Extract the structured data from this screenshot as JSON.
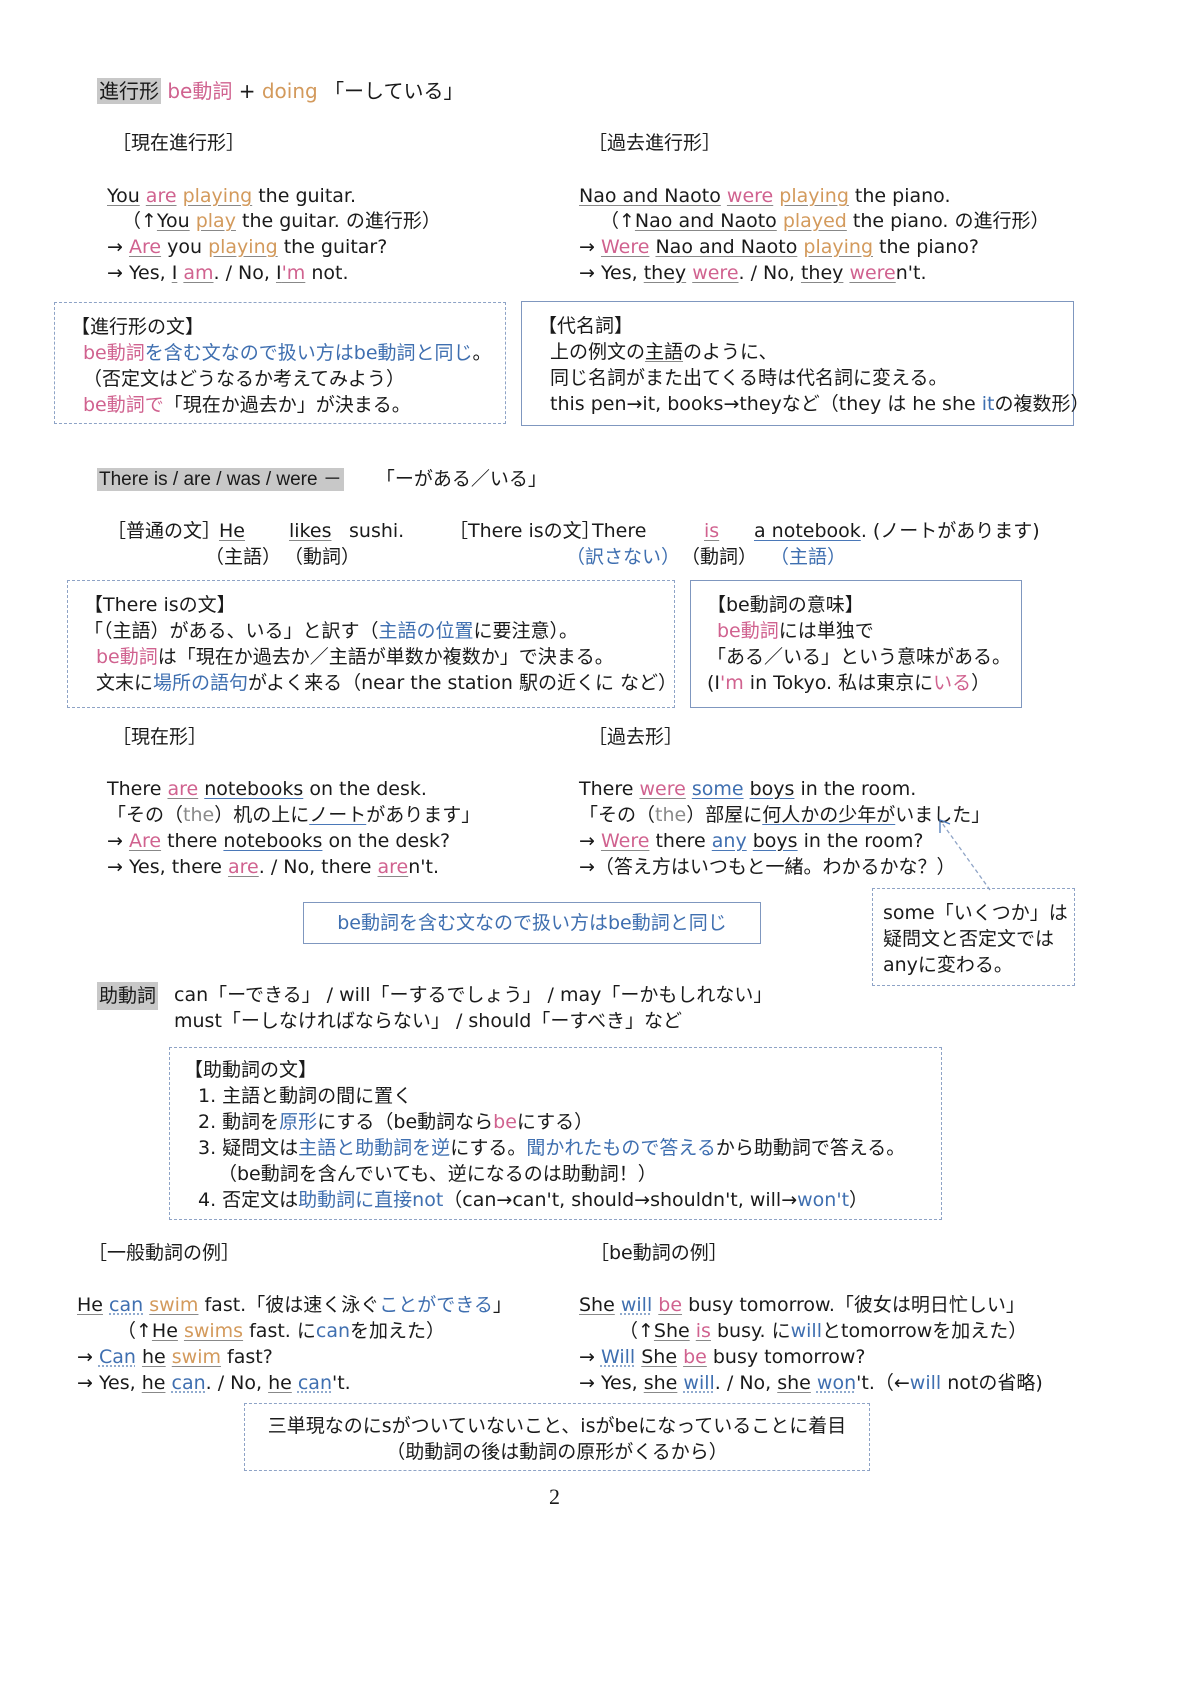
{
  "section1": {
    "heading_label": "進行形",
    "formula_be": "be動詞",
    "formula_plus": " + ",
    "formula_doing": "doing",
    "formula_meaning": "「ーしている」",
    "present_title": "［現在進行形］",
    "past_title": "［過去進行形］",
    "present_lines": [
      {
        "a": "You",
        "b": "are",
        "c": "playing",
        "d": " the guitar."
      },
      {
        "a": "（↑",
        "b": "You",
        "c": "play",
        "d": " the guitar. の進行形）"
      },
      {
        "a": "→ ",
        "b": "Are",
        "c": " you ",
        "d": "playing",
        "e": " the guitar?"
      },
      {
        "a": "→ Yes, ",
        "b": "I",
        "c": " ",
        "d": "am",
        "e": ". / No, ",
        "f": "I",
        "g": "'m",
        "h": " not."
      }
    ],
    "past_lines": [
      {
        "a": "Nao and Naoto",
        "b": "were",
        "c": "playing",
        "d": " the piano."
      },
      {
        "a": "（↑",
        "b": "Nao and Naoto",
        "c": "played",
        "d": " the piano. の進行形）"
      },
      {
        "a": "→ ",
        "b": "Were",
        "c": "Nao and Naoto",
        "d": "playing",
        "e": " the piano?"
      },
      {
        "a": "→ Yes, ",
        "b": "they",
        "c": "were",
        "d": ". / No, ",
        "e": "they",
        "f": "were",
        "g": "n't."
      }
    ],
    "box_progressive": {
      "title": "【進行形の文】",
      "l1_pink": "be動詞",
      "l1_blue": "を含む文なので扱い方はbe動詞と同じ",
      "l1_end": "。",
      "l2": "（否定文はどうなるか考えてみよう）",
      "l3_pink": "be動詞で",
      "l3_rest": "「現在か過去か」が決まる。"
    },
    "box_pronoun": {
      "title": "【代名詞】",
      "l1_a": "上の例文の",
      "l1_u": "主語",
      "l1_b": "のように、",
      "l2": "同じ名詞がまた出てくる時は代名詞に変える。",
      "l3_a": "this pen→it, books→theyなど（they は he she ",
      "l3_blue": "it",
      "l3_b": "の複数形）"
    }
  },
  "section2": {
    "heading_label": "There is / are / was / were －",
    "meaning": "「ーがある／いる」",
    "normal_label": "［普通の文］",
    "normal_he": "He",
    "normal_likes": "likes",
    "normal_sushi": "sushi.",
    "normal_subj": "（主語）",
    "normal_verb": "（動詞）",
    "there_label": "［There isの文］",
    "there_word": "There",
    "there_is": "is",
    "there_obj": "a notebook",
    "there_trans": ". (ノートがあります)",
    "there_not_translated": "（訳さない）",
    "there_verb": "（動詞）",
    "there_subj": "（主語）",
    "box_there": {
      "title": "【There isの文】",
      "l1_a": "「（主語）がある、いる」と訳す（",
      "l1_blue": "主語の位置",
      "l1_b": "に要注意）。",
      "l2_pink": "be動詞",
      "l2_rest": "は「現在か過去か／主語が単数か複数か」で決まる。",
      "l3_a": "文末に",
      "l3_blue": "場所の語句",
      "l3_b": "がよく来る（near the station 駅の近くに など）"
    },
    "box_be_meaning": {
      "title": "【be動詞の意味】",
      "l1_pink": "be動詞",
      "l1_rest": "には単独で",
      "l2": "「ある／いる」という意味がある。",
      "l3_a": "(I",
      "l3_pink": "'m",
      "l3_b": " in Tokyo. 私は東京に",
      "l3_pink2": "いる",
      "l3_c": "）"
    },
    "present_title": "［現在形］",
    "past_title": "［過去形］",
    "present_lines": [
      {
        "a": "There ",
        "b": "are",
        "c": " ",
        "d": "notebooks",
        "e": " on the desk."
      },
      {
        "a": "「その（",
        "b": "the",
        "c": "）机の上に",
        "d": "ノート",
        "e": "があります」"
      },
      {
        "a": "→ ",
        "b": "Are",
        "c": " there ",
        "d": "notebooks",
        "e": " on the desk?"
      },
      {
        "a": "→ Yes, there ",
        "b": "are",
        "c": ". / No, there ",
        "d": "are",
        "e": "n't."
      }
    ],
    "past_lines": [
      {
        "a": "There ",
        "b": "were",
        "c": " ",
        "d": "some",
        "e": " ",
        "f": "boys",
        "g": " in the room."
      },
      {
        "a": "「その（",
        "b": "the",
        "c": "）部屋に",
        "d": "何人かの少年が",
        "e": "いました」"
      },
      {
        "a": "→ ",
        "b": "Were",
        "c": " there ",
        "d": "any",
        "e": " ",
        "f": "boys",
        "g": " in the room?"
      },
      {
        "a": "→（答え方はいつもと一緒。わかるかな？）"
      }
    ],
    "callout_center": "be動詞を含む文なので扱い方はbe動詞と同じ",
    "callout_some": [
      "some「いくつか」は",
      "疑問文と否定文では",
      "anyに変わる。"
    ]
  },
  "section3": {
    "heading_label": "助動詞",
    "line1": "can「ーできる」 / will「ーするでしょう」 / may「ーかもしれない」",
    "line2": "must「ーしなければならない」 / should「ーすべき」など",
    "box_modal": {
      "title": "【助動詞の文】",
      "i1": "1. 主語と動詞の間に置く",
      "i2_a": "2. 動詞を",
      "i2_blue": "原形",
      "i2_b": "にする（be動詞なら",
      "i2_pink": "be",
      "i2_c": "にする）",
      "i3_a": "3. 疑問文は",
      "i3_blue1": "主語と助動詞を逆",
      "i3_b": "にする。",
      "i3_blue2": "聞かれたもので答える",
      "i3_c": "から助動詞で答える。",
      "i3_note": "（be動詞を含んでいても、逆になるのは助動詞！）",
      "i4_a": "4. 否定文は",
      "i4_blue": "助動詞に直接not",
      "i4_b": "（can→can't, should→shouldn't, will→",
      "i4_blue2": "won't",
      "i4_c": "）"
    },
    "general_title": "［一般動詞の例］",
    "be_title": "［be動詞の例］",
    "general_lines": [
      {
        "a": "He",
        "b": "can",
        "c": "swim",
        "d": " fast.「彼は速く泳ぐ",
        "e": "ことができる",
        "f": "」"
      },
      {
        "a": "（↑",
        "b": "He",
        "c": "swims",
        "d": " fast. に",
        "e": "can",
        "f": "を加えた）"
      },
      {
        "a": "→ ",
        "b": "Can",
        "c": "he",
        "d": "swim",
        "e": " fast?"
      },
      {
        "a": "→ Yes, ",
        "b": "he",
        "c": "can",
        "d": ". / No, ",
        "e": "he",
        "f": "can",
        "g": "'t."
      }
    ],
    "be_lines": [
      {
        "a": "She",
        "b": "will",
        "c": "be",
        "d": " busy tomorrow.「彼女は明日忙しい」"
      },
      {
        "a": "（↑",
        "b": "She",
        "c": "is",
        "d": " busy. に",
        "e": "will",
        "f": "とtomorrowを加えた）"
      },
      {
        "a": "→ ",
        "b": "Will",
        "c": "She",
        "d": "be",
        "e": " busy tomorrow?"
      },
      {
        "a": "→ Yes, ",
        "b": "she",
        "c": "will",
        "d": ". / No, ",
        "e": "she",
        "f": "won",
        "g": "'t.（←",
        "h": "will",
        "i": " notの省略)"
      }
    ],
    "callout_bottom": [
      "三単現なのにsがついていないこと、isがbeになっていることに着目",
      "（助動詞の後は動詞の原形がくるから）"
    ]
  },
  "page_number": "2"
}
